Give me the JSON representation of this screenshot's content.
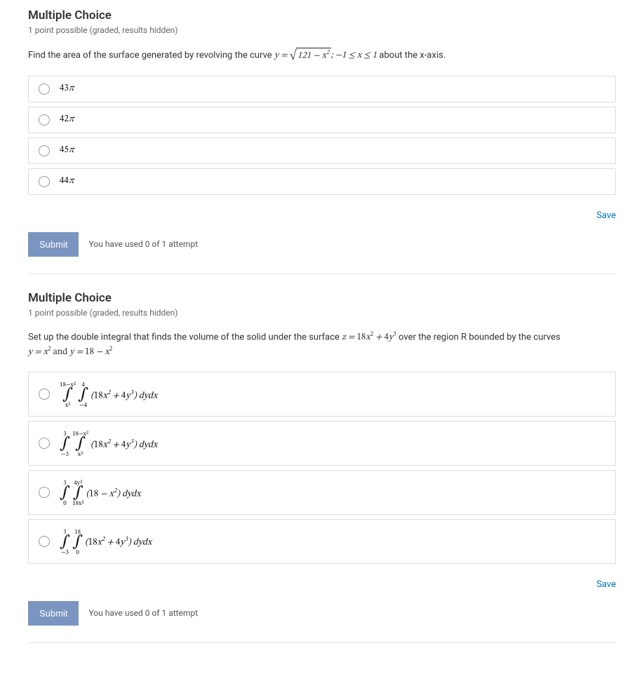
{
  "q1": {
    "title": "Multiple Choice",
    "meta": "1 point possible (graded, results hidden)",
    "prompt_pre": "Find the area of the surface generated by revolving the curve ",
    "prompt_formula": "y = √(121 − x²); −1 ≤ x ≤ 1",
    "prompt_post": " about the x-axis.",
    "options": {
      "a": "43π",
      "b": "42π",
      "c": "45π",
      "d": "44π"
    },
    "save": "Save",
    "submit": "Submit",
    "attempts": "You have used 0 of 1 attempt"
  },
  "q2": {
    "title": "Multiple Choice",
    "meta": "1 point possible (graded, results hidden)",
    "prompt_pre": "Set up the double integral that finds the volume of the solid under the surface ",
    "prompt_surface": "z = 18x² + 4y³",
    "prompt_mid": " over the region R bounded by the curves",
    "prompt_curves": "y = x² and y = 18 − x²",
    "options": {
      "a": {
        "outer_top": "18−x²",
        "outer_bot": "x²",
        "inner_top": "4",
        "inner_bot": "−4",
        "body": "(18x² + 4y³) dydx"
      },
      "b": {
        "outer_top": "3",
        "outer_bot": "−3",
        "inner_top": "18−x²",
        "inner_bot": "x²",
        "body": "(18x² + 4y³) dydx"
      },
      "c": {
        "outer_top": "3",
        "outer_bot": "0",
        "inner_top": "4y²",
        "inner_bot": "18x²",
        "body": "(18 − x²) dydx"
      },
      "d": {
        "outer_top": "3",
        "outer_bot": "−3",
        "inner_top": "18",
        "inner_bot": "0",
        "body": "(18x² + 4y³) dydx"
      }
    },
    "save": "Save",
    "submit": "Submit",
    "attempts": "You have used 0 of 1 attempt"
  }
}
